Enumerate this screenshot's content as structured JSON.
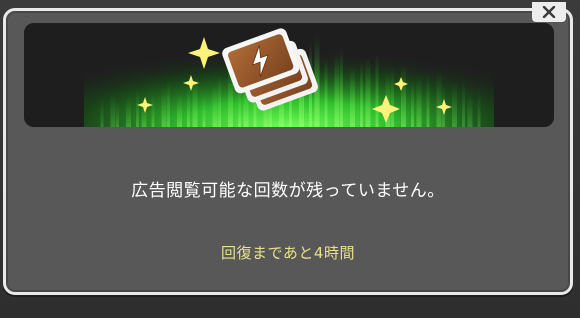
{
  "dialog": {
    "message": "広告閲覧可能な回数が残っていません。",
    "recovery": "回復まであと4時間"
  },
  "icons": {
    "banner": "stacked-tickets-lightning-icon",
    "sparkle": "sparkle-icon",
    "close": "close-icon"
  },
  "colors": {
    "accent_text": "#e8e28a",
    "glow": "#3ee03a",
    "ticket": "#9a5a2e",
    "sparkle": "#fff27a"
  }
}
